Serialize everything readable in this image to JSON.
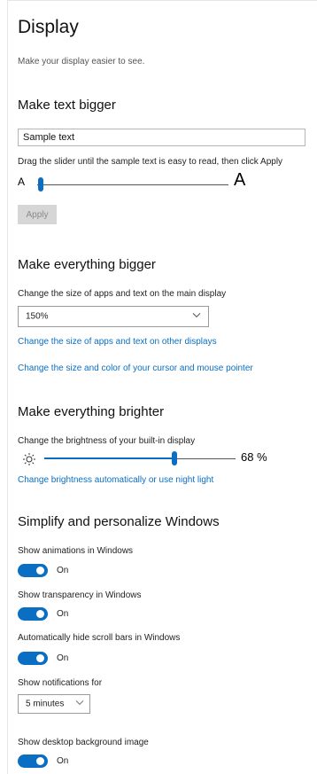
{
  "page": {
    "title": "Display",
    "subtitle": "Make your display easier to see."
  },
  "text_bigger": {
    "heading": "Make text bigger",
    "sample_value": "Sample text",
    "instruction": "Drag the slider until the sample text is easy to read, then click Apply",
    "small_a": "A",
    "large_a": "A",
    "slider_level": 0.0,
    "apply_label": "Apply"
  },
  "everything_bigger": {
    "heading": "Make everything bigger",
    "description": "Change the size of apps and text on the main display",
    "scale_selected": "150%",
    "link_other_displays": "Change the size of apps and text on other displays",
    "link_cursor": "Change the size and color of your cursor and mouse pointer"
  },
  "everything_brighter": {
    "heading": "Make everything brighter",
    "description": "Change the brightness of your built-in display",
    "brightness_value": "68 %",
    "brightness_level": 0.68,
    "link_night_light": "Change brightness automatically or use night light"
  },
  "simplify": {
    "heading": "Simplify and personalize Windows",
    "animations_label": "Show animations in Windows",
    "animations_state": "On",
    "transparency_label": "Show transparency in Windows",
    "transparency_state": "On",
    "scrollbars_label": "Automatically hide scroll bars in Windows",
    "scrollbars_state": "On",
    "notifications_label": "Show notifications for",
    "notifications_selected": "5 minutes",
    "background_label": "Show desktop background image",
    "background_state": "On"
  },
  "colors": {
    "accent": "#0a6fc2",
    "link": "#0a6fc2"
  },
  "icons": {
    "brightness": "sun-icon",
    "dropdown": "chevron-down-icon"
  }
}
